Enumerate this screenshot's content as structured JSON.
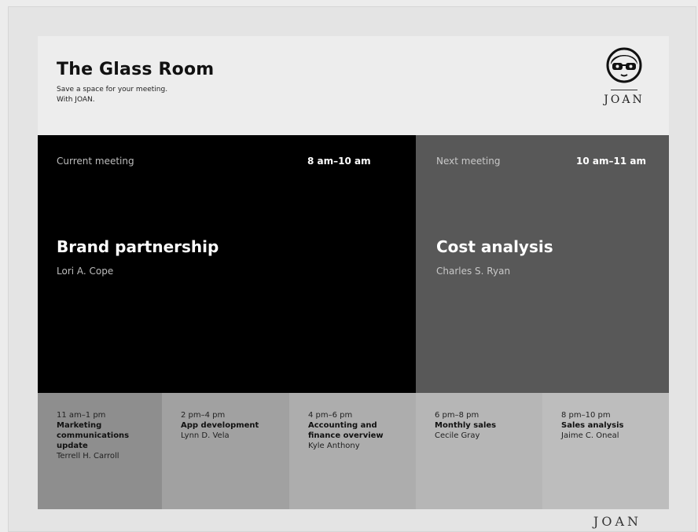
{
  "room": {
    "title": "The Glass Room",
    "tagline_line1": "Save a space for your meeting.",
    "tagline_line2": "With JOAN.",
    "logo_icon": "joan-girl-glasses-icon",
    "logo_word": "JOAN"
  },
  "current_meeting": {
    "label": "Current meeting",
    "time": "8 am–10 am",
    "title": "Brand partnership",
    "organizer": "Lori A. Cope",
    "background": "#000000"
  },
  "next_meeting": {
    "label": "Next meeting",
    "time": "10 am–11 am",
    "title": "Cost analysis",
    "organizer": "Charles S. Ryan",
    "background": "#585858"
  },
  "upcoming": [
    {
      "time": "11 am–1 pm",
      "title": "Marketing communications update",
      "organizer": "Terrell H. Carroll",
      "color": "#8e8e8e"
    },
    {
      "time": "2 pm–4 pm",
      "title": "App development",
      "organizer": "Lynn D. Vela",
      "color": "#a1a1a1"
    },
    {
      "time": "4 pm–6 pm",
      "title": "Accounting and finance overview",
      "organizer": "Kyle Anthony",
      "color": "#adadad"
    },
    {
      "time": "6 pm–8 pm",
      "title": "Monthly sales",
      "organizer": "Cecile Gray",
      "color": "#b6b6b6"
    },
    {
      "time": "8 pm–10 pm",
      "title": "Sales analysis",
      "organizer": "Jaime C. Oneal",
      "color": "#bdbdbd"
    }
  ],
  "device_brand": "JOAN"
}
